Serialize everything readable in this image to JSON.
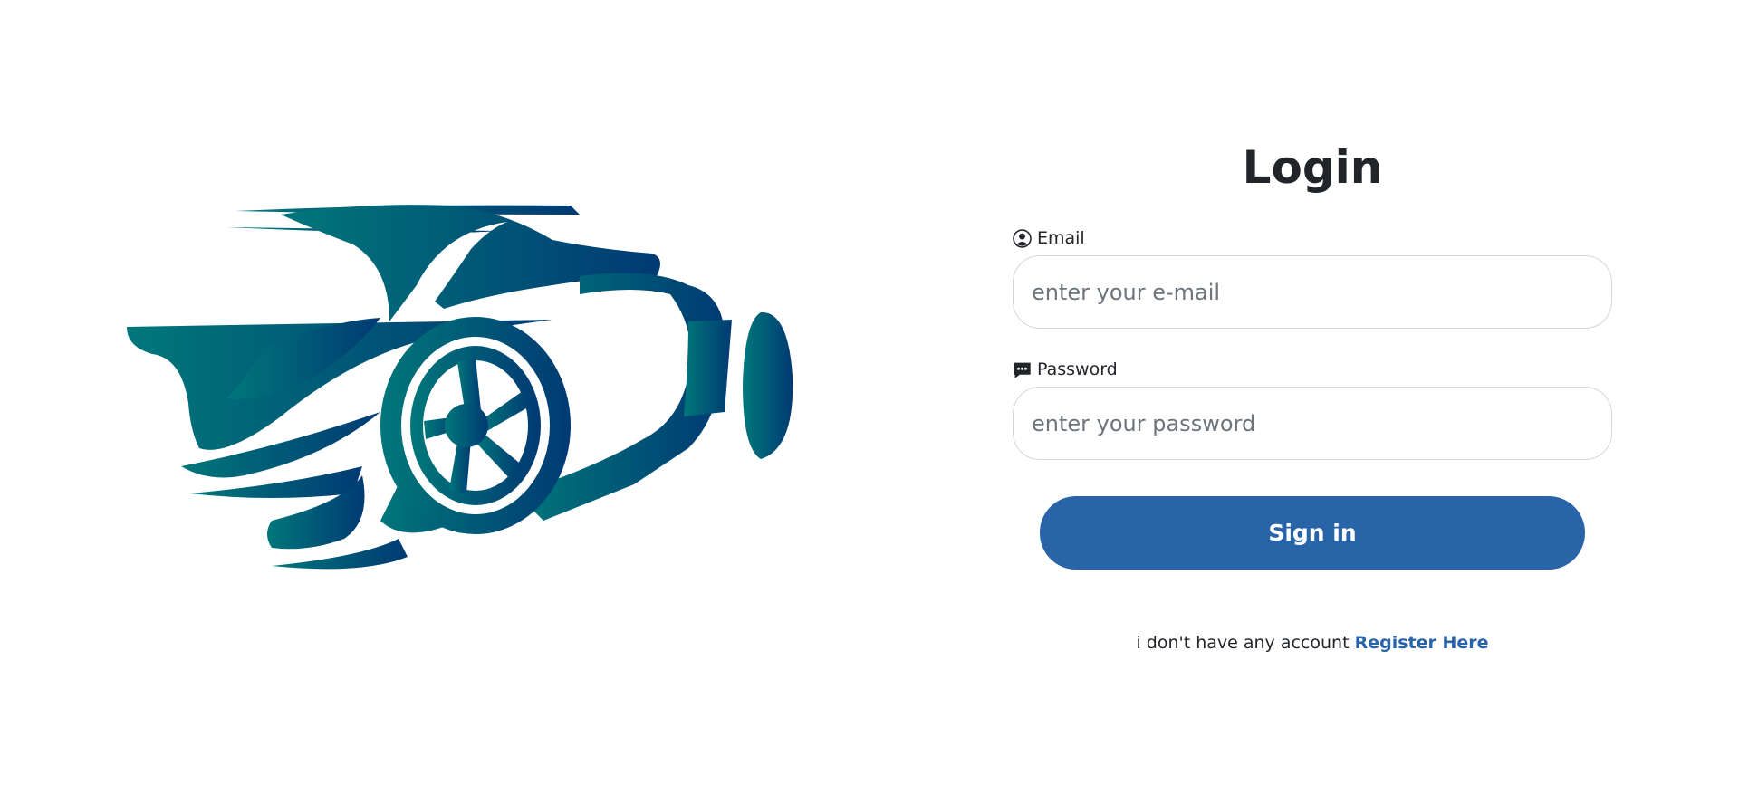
{
  "login": {
    "title": "Login",
    "email": {
      "label": "Email",
      "placeholder": "enter your e-mail",
      "value": ""
    },
    "password": {
      "label": "Password",
      "placeholder": "enter your password",
      "value": ""
    },
    "signin_label": "Sign in",
    "register_prompt": "i don't have any account",
    "register_link": "Register Here"
  },
  "icons": {
    "email": "user-circle-icon",
    "password": "chat-dots-icon",
    "illustration": "sports-car-logo"
  },
  "colors": {
    "primary": "#2964a8",
    "car_gradient_start": "#00777a",
    "car_gradient_end": "#003a73"
  }
}
